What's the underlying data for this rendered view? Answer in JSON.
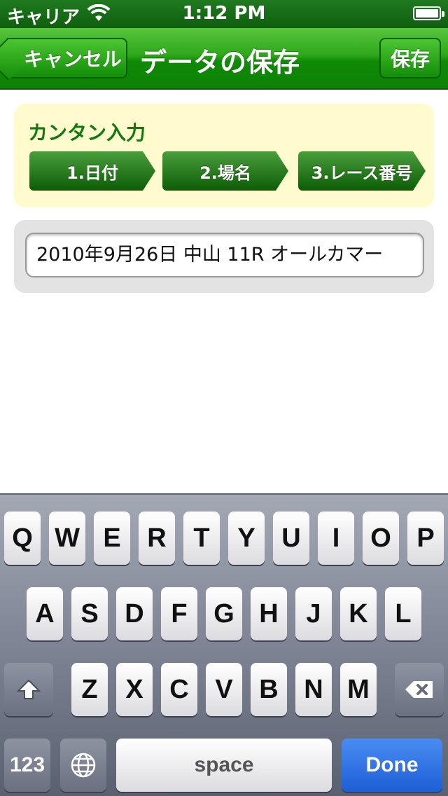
{
  "status_bar": {
    "carrier": "キャリア",
    "time": "1:12 PM",
    "wifi_icon": "wifi-icon",
    "battery_icon": "battery-icon"
  },
  "nav": {
    "title": "データの保存",
    "cancel_label": "キャンセル",
    "save_label": "保存"
  },
  "quick_input": {
    "title": "カンタン入力",
    "steps": [
      "1.日付",
      "2.場名",
      "3.レース番号"
    ]
  },
  "text_field": {
    "value": "2010年9月26日 中山 11R オールカマー"
  },
  "keyboard": {
    "row1": [
      "Q",
      "W",
      "E",
      "R",
      "T",
      "Y",
      "U",
      "I",
      "O",
      "P"
    ],
    "row2": [
      "A",
      "S",
      "D",
      "F",
      "G",
      "H",
      "J",
      "K",
      "L"
    ],
    "row3": [
      "Z",
      "X",
      "C",
      "V",
      "B",
      "N",
      "M"
    ],
    "numbers_label": "123",
    "space_label": "space",
    "done_label": "Done",
    "shift_icon": "shift-icon",
    "delete_icon": "delete-icon",
    "globe_icon": "globe-icon"
  },
  "colors": {
    "nav_green": "#2ea81a",
    "panel_yellow": "#fffbcf",
    "done_blue": "#1d5fd6"
  }
}
